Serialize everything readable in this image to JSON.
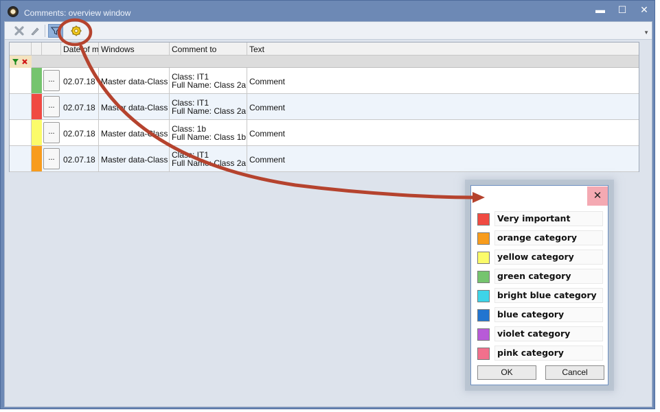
{
  "window": {
    "title": "Comments: overview window",
    "minimize_glyph": "▬",
    "maximize_glyph": "☐",
    "close_glyph": "✕"
  },
  "toolbar": {
    "delete_icon": "delete-icon",
    "edit_icon": "pen-icon",
    "filter_icon": "filter-icon",
    "settings_icon": "category-settings-icon",
    "more_glyph": "▼"
  },
  "grid": {
    "columns": [
      "Date of mo",
      "Windows",
      "Comment to",
      "Text"
    ],
    "more_glyph": "...",
    "rows": [
      {
        "color": "#75c46e",
        "date": "02.07.18",
        "window": "Master data-Class",
        "comment_to_1": "Class: IT1",
        "comment_to_2": "Full Name: Class 2a",
        "text": "Comment"
      },
      {
        "color": "#f04a42",
        "date": "02.07.18",
        "window": "Master data-Class",
        "comment_to_1": "Class: IT1",
        "comment_to_2": "Full Name: Class 2a",
        "text": "Comment"
      },
      {
        "color": "#fbfb6a",
        "date": "02.07.18",
        "window": "Master data-Class",
        "comment_to_1": "Class: 1b",
        "comment_to_2": "Full Name: Class 1b",
        "text": "Comment"
      },
      {
        "color": "#f89c1d",
        "date": "02.07.18",
        "window": "Master data-Class",
        "comment_to_1": "Class: IT1",
        "comment_to_2": "Full Name: Class 2a",
        "text": "Comment"
      }
    ]
  },
  "dialog": {
    "close_glyph": "✕",
    "categories": [
      {
        "label": "Very important",
        "color": "#f04a42"
      },
      {
        "label": "orange category",
        "color": "#f89c1d"
      },
      {
        "label": "yellow category",
        "color": "#fbfb6a"
      },
      {
        "label": "green category",
        "color": "#75c46e"
      },
      {
        "label": "bright blue category",
        "color": "#3dd4e8"
      },
      {
        "label": "blue category",
        "color": "#2275d0"
      },
      {
        "label": "violet category",
        "color": "#b85ad8"
      },
      {
        "label": "pink category",
        "color": "#f2708c"
      }
    ],
    "ok_label": "OK",
    "cancel_label": "Cancel"
  },
  "annotation": {
    "color": "#b5432e"
  }
}
